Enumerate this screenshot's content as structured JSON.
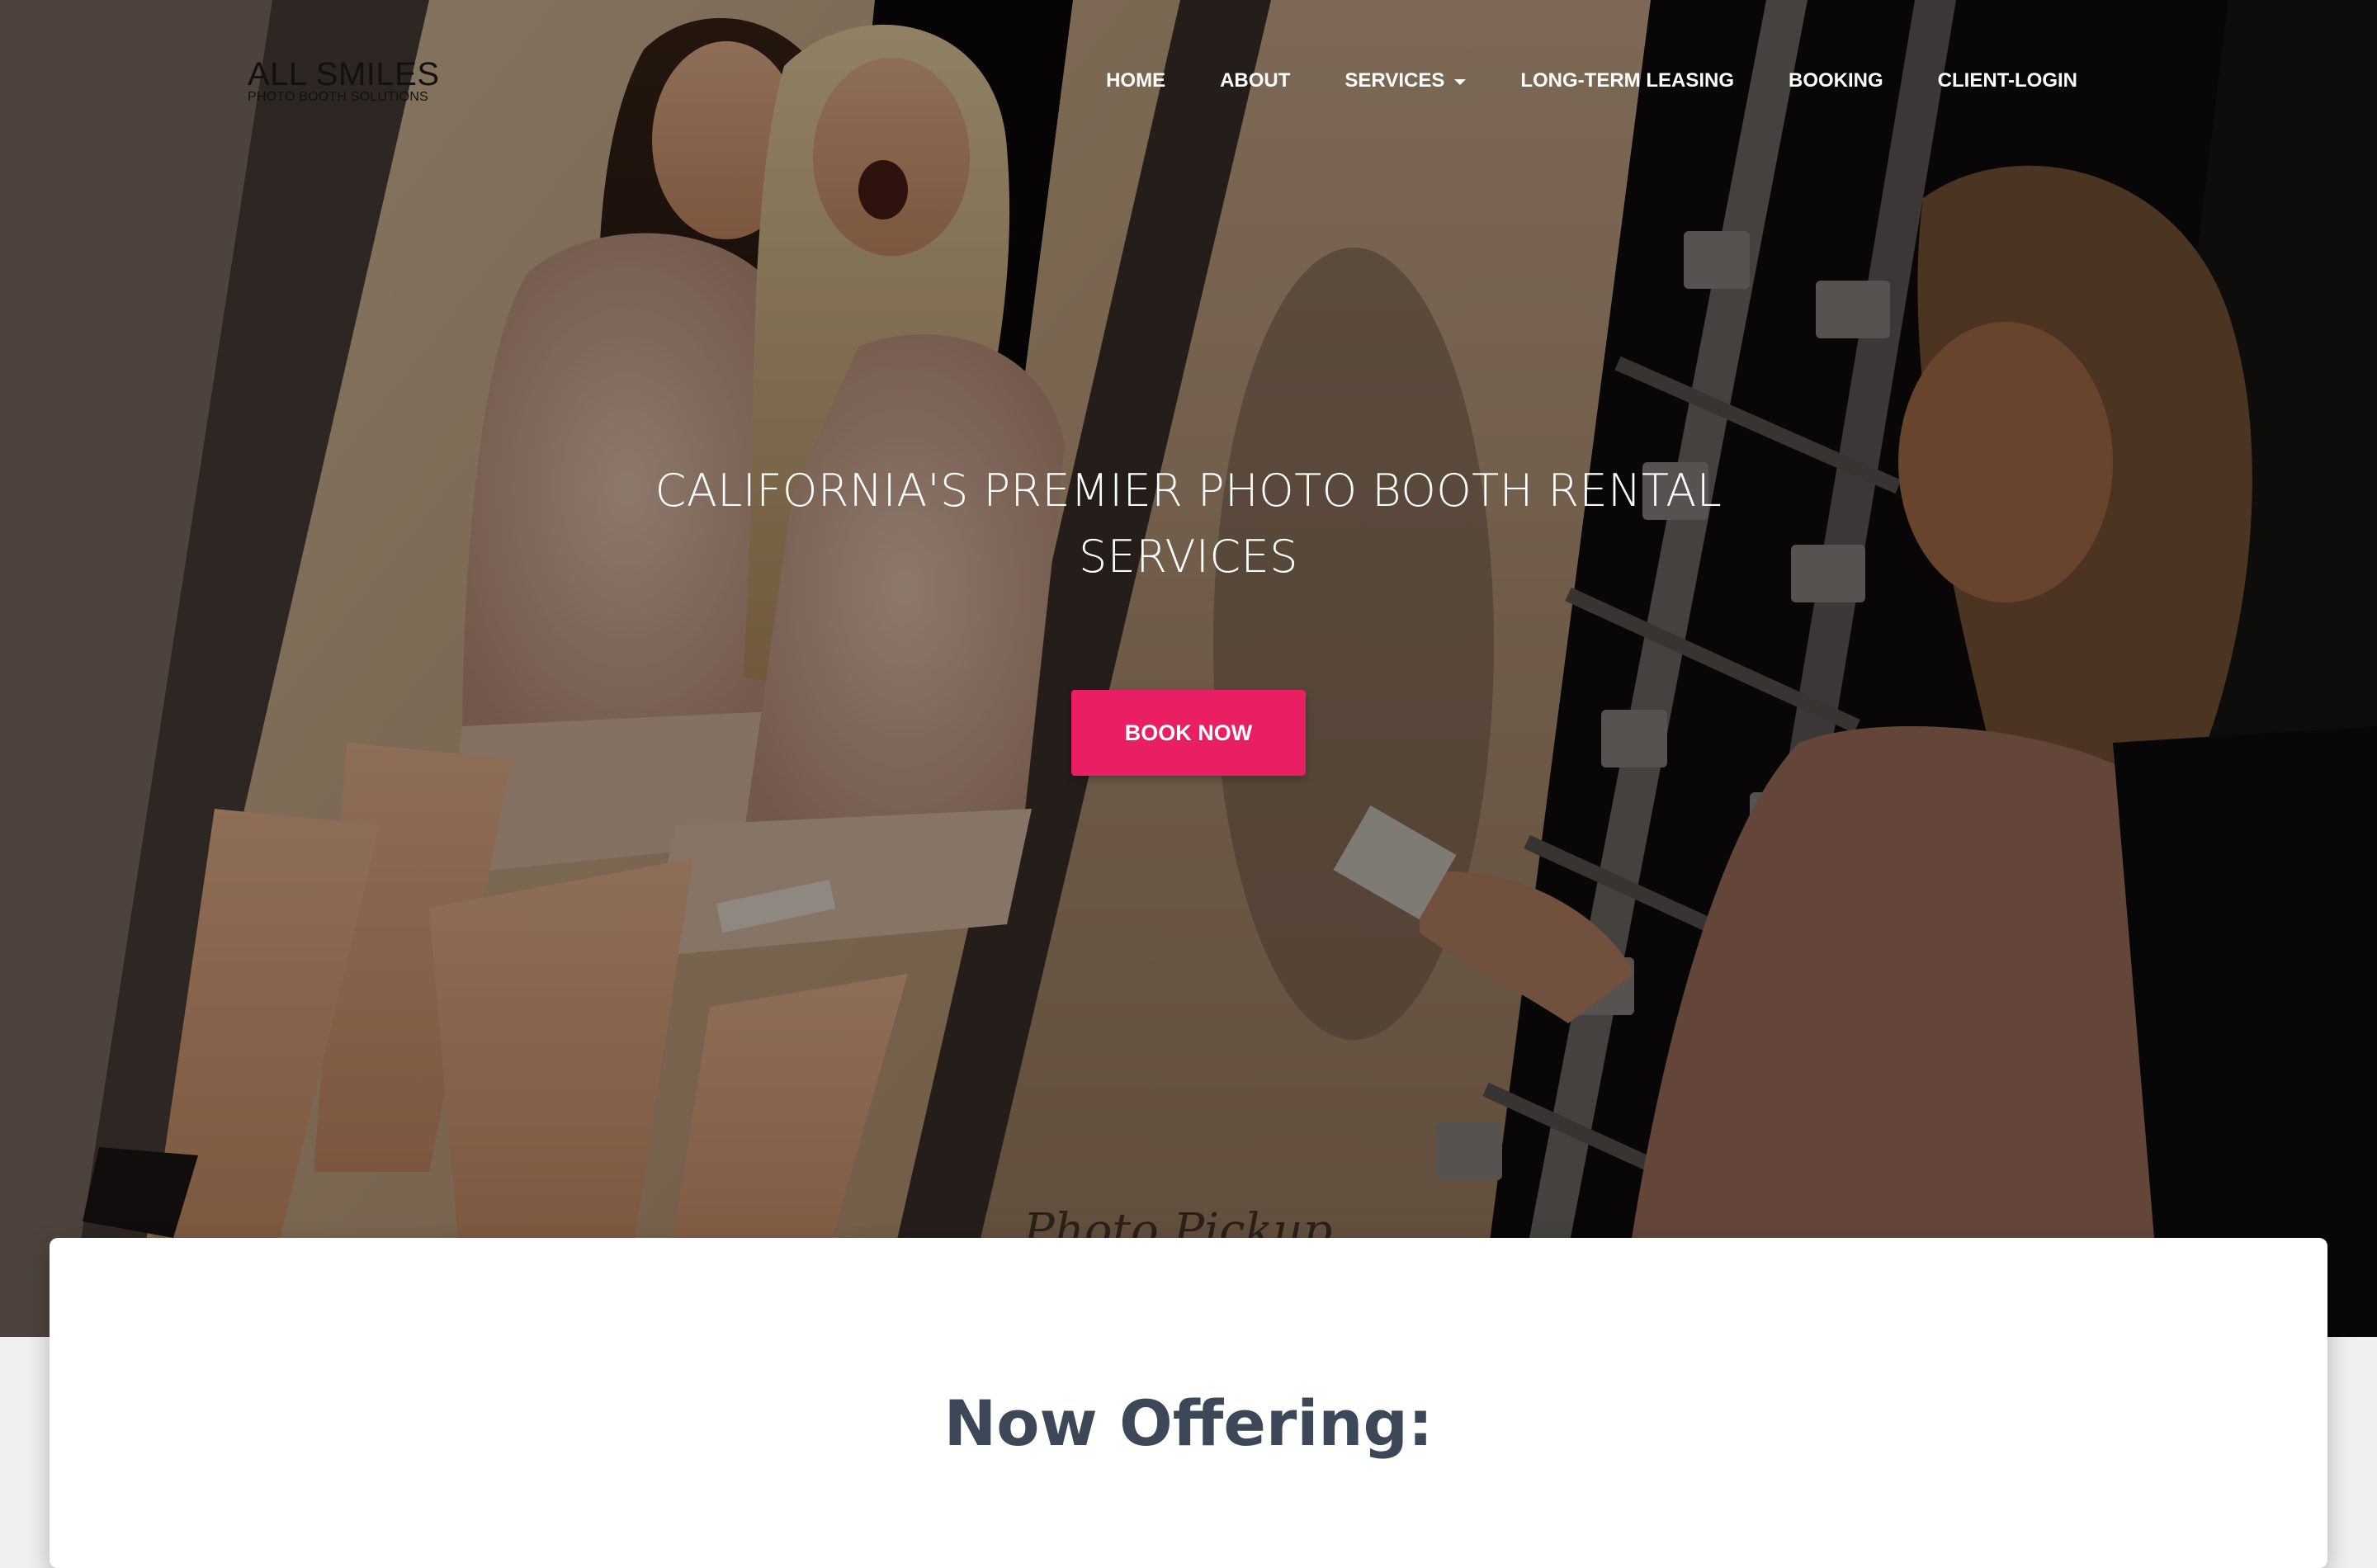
{
  "brand": {
    "title": "ALL SMILES",
    "subtitle": "PHOTO BOOTH SOLUTIONS"
  },
  "nav": {
    "items": [
      {
        "label": "HOME"
      },
      {
        "label": "ABOUT"
      },
      {
        "label": "SERVICES",
        "has_dropdown": true
      },
      {
        "label": "LONG-TERM LEASING"
      },
      {
        "label": "BOOKING"
      },
      {
        "label": "CLIENT-LOGIN"
      }
    ]
  },
  "hero": {
    "title": "CALIFORNIA'S PREMIER PHOTO BOOTH RENTAL SERVICES",
    "cta_label": "BOOK NOW",
    "background_image": "photo-booth-scene"
  },
  "content": {
    "section_title": "Now Offering:"
  },
  "colors": {
    "accent": "#e91e63",
    "heading": "#3c4858",
    "nav_text": "#ffffff",
    "page_background": "#f0f0f0"
  }
}
